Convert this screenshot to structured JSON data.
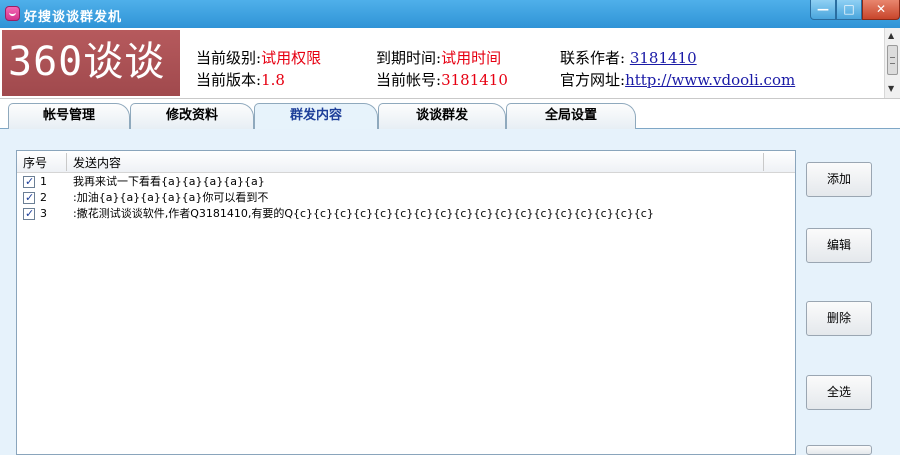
{
  "window": {
    "title": "好搜谈谈群发机",
    "controls": {
      "minimize": "—",
      "maximize": "□",
      "close": "✕"
    }
  },
  "header": {
    "logo_text": "360谈谈",
    "level_label": "当前级别:",
    "level_value": "试用权限",
    "version_label": "当前版本:",
    "version_value": "1.8",
    "expire_label": "到期时间:",
    "expire_value": "试用时间",
    "account_label": "当前帐号:",
    "account_value": "3181410",
    "contact_label": "联系作者: ",
    "contact_value": "3181410",
    "site_label": "官方网址:",
    "site_value": "http://www.vdooli.com"
  },
  "tabs": [
    {
      "label": "帐号管理",
      "active": false
    },
    {
      "label": "修改资料",
      "active": false
    },
    {
      "label": "群发内容",
      "active": true
    },
    {
      "label": "谈谈群发",
      "active": false
    },
    {
      "label": "全局设置",
      "active": false
    }
  ],
  "list": {
    "columns": [
      "序号",
      "发送内容"
    ],
    "rows": [
      {
        "checked": true,
        "num": "1",
        "content": "我再来试一下看看{a}{a}{a}{a}{a}"
      },
      {
        "checked": true,
        "num": "2",
        "content": ":加油{a}{a}{a}{a}{a}你可以看到不"
      },
      {
        "checked": true,
        "num": "3",
        "content": ":撒花测试谈谈软件,作者Q3181410,有要的Q{c}{c}{c}{c}{c}{c}{c}{c}{c}{c}{c}{c}{c}{c}{c}{c}{c}{c}"
      }
    ]
  },
  "buttons": {
    "add": "添加",
    "edit": "编辑",
    "delete": "删除",
    "select_all": "全选"
  },
  "colors": {
    "titlebar": "#2f93d6",
    "logo_bg": "#a0494d",
    "highlight_red": "#e60012",
    "link_blue": "#1a1aa6",
    "panel_bg": "#e6f2fb",
    "active_tab_text": "#1e3f99"
  }
}
